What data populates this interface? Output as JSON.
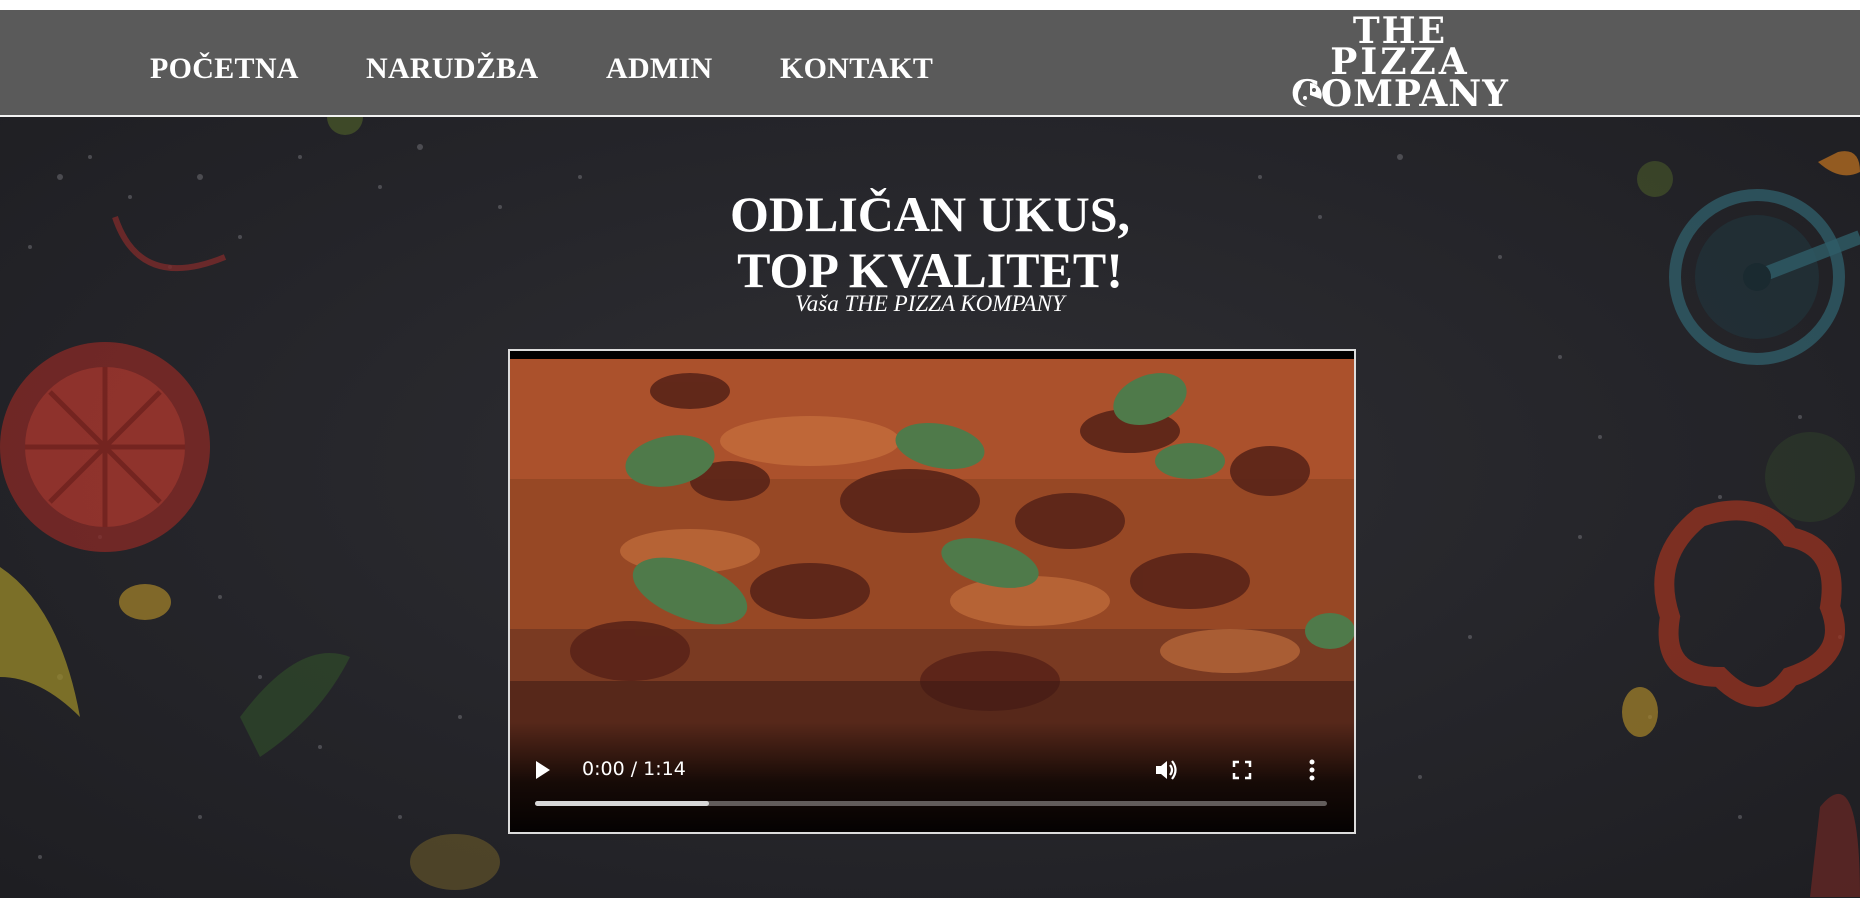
{
  "nav": {
    "items": [
      {
        "label": "POČETNA"
      },
      {
        "label": "NARUDŽBA"
      },
      {
        "label": "ADMIN"
      },
      {
        "label": "KONTAKT"
      }
    ]
  },
  "logo": {
    "line1": "THE",
    "line2": "PIZZA",
    "line3": "COMPANY"
  },
  "hero": {
    "headline_line1": "ODLIČAN UKUS,",
    "headline_line2": "TOP KVALITET!",
    "subline": "Vaša THE PIZZA KOMPANY"
  },
  "video": {
    "time_display": "0:00 / 1:14",
    "buffered_fraction": 0.22,
    "icons": [
      "play-icon",
      "volume-icon",
      "fullscreen-icon",
      "more-options-icon"
    ]
  },
  "colors": {
    "navbar": "#5a5a5a",
    "hero_bg": "#2b2b2f",
    "text": "#ffffff"
  }
}
